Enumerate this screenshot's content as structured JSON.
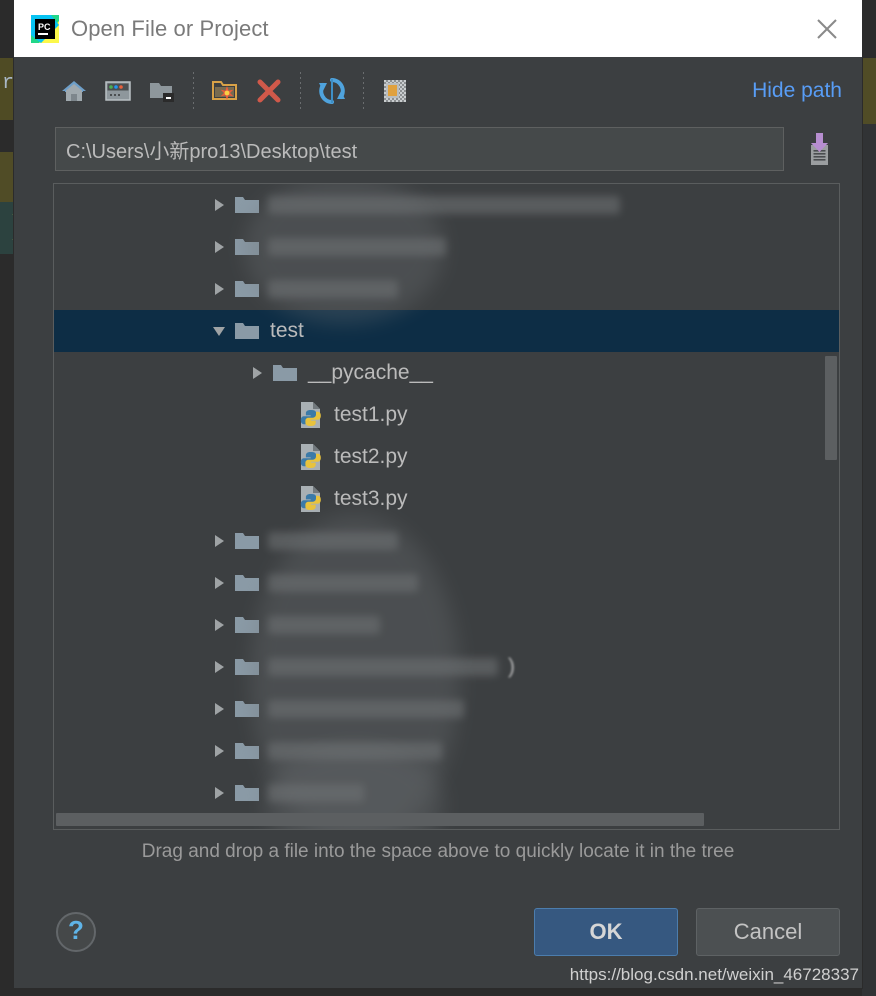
{
  "window": {
    "title": "Open File or Project",
    "app_icon": "pycharm-logo-icon",
    "close_icon": "close-icon"
  },
  "toolbar": {
    "items": [
      {
        "name": "home-icon",
        "tooltip": "Home"
      },
      {
        "name": "desktop-icon",
        "tooltip": "Desktop"
      },
      {
        "name": "project-folder-icon",
        "tooltip": "Project Directory"
      },
      {
        "name": "new-folder-icon",
        "tooltip": "New Folder"
      },
      {
        "name": "delete-icon",
        "tooltip": "Delete"
      },
      {
        "name": "refresh-icon",
        "tooltip": "Refresh"
      },
      {
        "name": "show-hidden-icon",
        "tooltip": "Show Hidden Files"
      }
    ],
    "hide_path_label": "Hide path"
  },
  "path_field": {
    "value": "C:\\Users\\小新pro13\\Desktop\\test",
    "placeholder": "",
    "load_icon": "load-into-field-icon"
  },
  "tree": {
    "rows": [
      {
        "kind": "redacted",
        "expander": "collapsed",
        "icon": "folder-icon",
        "label": "",
        "indent": 1,
        "redacted_width": 352,
        "selected": false
      },
      {
        "kind": "redacted",
        "expander": "collapsed",
        "icon": "folder-icon",
        "label": "",
        "indent": 1,
        "redacted_width": 178,
        "selected": false
      },
      {
        "kind": "redacted",
        "expander": "collapsed",
        "icon": "folder-icon",
        "label": "",
        "indent": 1,
        "redacted_width": 130,
        "selected": false
      },
      {
        "kind": "folder",
        "expander": "expanded",
        "icon": "folder-icon",
        "label": "test",
        "indent": 1,
        "selected": true
      },
      {
        "kind": "folder",
        "expander": "collapsed",
        "icon": "folder-icon",
        "label": "__pycache__",
        "indent": 2,
        "selected": false
      },
      {
        "kind": "file",
        "expander": "none",
        "icon": "python-file-icon",
        "label": "test1.py",
        "indent": 2,
        "selected": false
      },
      {
        "kind": "file",
        "expander": "none",
        "icon": "python-file-icon",
        "label": "test2.py",
        "indent": 2,
        "selected": false
      },
      {
        "kind": "file",
        "expander": "none",
        "icon": "python-file-icon",
        "label": "test3.py",
        "indent": 2,
        "selected": false
      },
      {
        "kind": "redacted",
        "expander": "collapsed",
        "icon": "folder-icon",
        "label": "",
        "indent": 1,
        "redacted_width": 130,
        "selected": false
      },
      {
        "kind": "redacted",
        "expander": "collapsed",
        "icon": "folder-icon",
        "label": "",
        "indent": 1,
        "redacted_width": 150,
        "selected": false
      },
      {
        "kind": "redacted",
        "expander": "collapsed",
        "icon": "folder-icon",
        "label": "",
        "indent": 1,
        "redacted_width": 112,
        "selected": false
      },
      {
        "kind": "redacted",
        "expander": "collapsed",
        "icon": "folder-icon",
        "label": "",
        "indent": 1,
        "redacted_width": 230,
        "trailing_text": ")",
        "selected": false
      },
      {
        "kind": "redacted",
        "expander": "collapsed",
        "icon": "folder-icon",
        "label": "",
        "indent": 1,
        "redacted_width": 196,
        "selected": false
      },
      {
        "kind": "redacted",
        "expander": "collapsed",
        "icon": "folder-icon",
        "label": "",
        "indent": 1,
        "redacted_width": 174,
        "selected": false
      },
      {
        "kind": "redacted",
        "expander": "collapsed",
        "icon": "folder-icon",
        "label": "",
        "indent": 1,
        "redacted_width": 96,
        "selected": false
      }
    ],
    "vertical_scrollbar": "visible",
    "horizontal_scrollbar": "visible"
  },
  "hint": "Drag and drop a file into the space above to quickly locate it in the tree",
  "footer": {
    "help_icon": "help-question-icon",
    "ok_label": "OK",
    "cancel_label": "Cancel"
  },
  "watermark": "https://blog.csdn.net/weixin_46728337",
  "background_ide": {
    "left_text": "re",
    "left_paren": ")"
  },
  "colors": {
    "dialog_bg": "#3c3f41",
    "titlebar_bg": "#ffffff",
    "title_text": "#7a7a7a",
    "accent_link": "#589df6",
    "selection_row": "#0d2d45",
    "ok_button": "#365880",
    "cancel_button": "#4c5052",
    "text": "#bbbbbb",
    "field_bg": "#45494a"
  }
}
